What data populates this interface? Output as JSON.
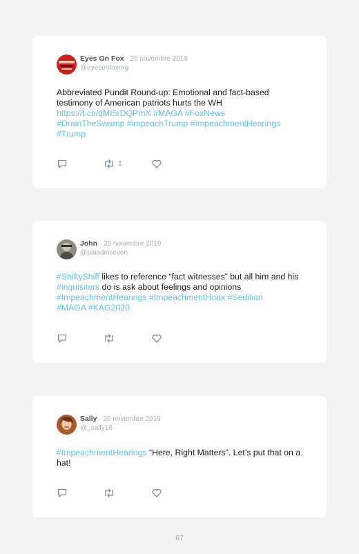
{
  "tweets": [
    {
      "name": "Eyes On Fox",
      "separator": " · ",
      "date": "20 novembre 2019",
      "handle": "@eyesonfoxorg",
      "text_parts": [
        {
          "t": "Abbreviated Pundit Round-up: Emotional and fact-based testimony of American patriots hurts the WH\n",
          "link": false
        },
        {
          "t": "https://t.co/qMI5rDQPmX",
          "link": true
        },
        {
          "t": " ",
          "link": false
        },
        {
          "t": "#MAGA",
          "link": true
        },
        {
          "t": " ",
          "link": false
        },
        {
          "t": "#FoxNews",
          "link": true
        },
        {
          "t": "\n",
          "link": false
        },
        {
          "t": "#DrainTheSwamp",
          "link": true
        },
        {
          "t": " ",
          "link": false
        },
        {
          "t": "#impeachTrump",
          "link": true
        },
        {
          "t": " ",
          "link": false
        },
        {
          "t": "#ImpeachmentHearings",
          "link": true
        },
        {
          "t": "\n",
          "link": false
        },
        {
          "t": "#Trump",
          "link": true
        }
      ],
      "retweet_count": "1",
      "avatar_colors": [
        "#c8211d",
        "#f2c7b6"
      ]
    },
    {
      "name": "John",
      "separator": " · ",
      "date": "20 novembre 2019",
      "handle": "@paladinseven",
      "text_parts": [
        {
          "t": "#ShiftyShiff",
          "link": true
        },
        {
          "t": " likes to reference “fact witnesses” but all him and his ",
          "link": false
        },
        {
          "t": "#inquisitors",
          "link": true
        },
        {
          "t": " do is ask about feelings and opinions\n",
          "link": false
        },
        {
          "t": "#ImpeachmentHearings",
          "link": true
        },
        {
          "t": " ",
          "link": false
        },
        {
          "t": "#ImpeachmentHoax",
          "link": true
        },
        {
          "t": " ",
          "link": false
        },
        {
          "t": "#Sedition",
          "link": true
        },
        {
          "t": "\n",
          "link": false
        },
        {
          "t": "#MAGA",
          "link": true
        },
        {
          "t": " ",
          "link": false
        },
        {
          "t": "#KAG2020",
          "link": true
        }
      ],
      "retweet_count": "",
      "avatar_colors": [
        "#6f6d62",
        "#c8c2b4"
      ]
    },
    {
      "name": "Sally",
      "separator": " · ",
      "date": "20 novembre 2019",
      "handle": "@_sally16",
      "text_parts": [
        {
          "t": "#ImpeachmentHearings",
          "link": true
        },
        {
          "t": " “Here, Right Matters”. Let’s put that on a hat!",
          "link": false
        }
      ],
      "retweet_count": "",
      "avatar_colors": [
        "#a85a2c",
        "#f0c9a8"
      ]
    }
  ],
  "page_number": "67",
  "colors": {
    "background": "#f3f3f3",
    "card": "#ffffff",
    "link": "#62c1ea",
    "muted": "#a8b0b6",
    "icon": "#7d8a94"
  },
  "icons": [
    "reply-icon",
    "retweet-icon",
    "like-icon"
  ]
}
